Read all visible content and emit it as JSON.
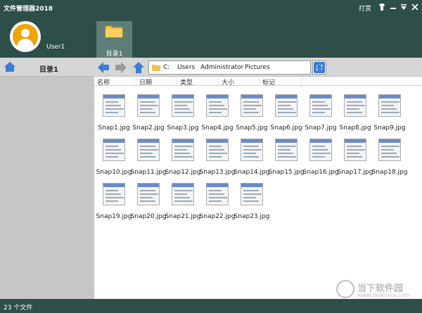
{
  "window": {
    "title": "文件管理器2018",
    "reward_label": "打赏",
    "controls": [
      "shirt-icon",
      "minimize-icon",
      "menu-icon",
      "close-icon"
    ]
  },
  "user": {
    "name": "User1"
  },
  "tabs": [
    {
      "label": "目录1"
    }
  ],
  "left_panel": {
    "title": "目录1"
  },
  "path": {
    "segments": [
      "C:",
      "Users",
      "Administrator",
      "Pictures"
    ]
  },
  "columns": [
    "名称",
    "日期",
    "类型",
    "大小",
    "标记"
  ],
  "files": [
    {
      "name": "Snap1.jpg"
    },
    {
      "name": "Snap2.jpg"
    },
    {
      "name": "Snap3.jpg"
    },
    {
      "name": "Snap4.jpg"
    },
    {
      "name": "Snap5.jpg"
    },
    {
      "name": "Snap6.jpg"
    },
    {
      "name": "Snap7.jpg"
    },
    {
      "name": "Snap8.jpg"
    },
    {
      "name": "Snap9.jpg"
    },
    {
      "name": "Snap10.jpg"
    },
    {
      "name": "Snap11.jpg"
    },
    {
      "name": "Snap12.jpg"
    },
    {
      "name": "Snap13.jpg"
    },
    {
      "name": "Snap14.jpg"
    },
    {
      "name": "Snap15.jpg"
    },
    {
      "name": "Snap16.jpg"
    },
    {
      "name": "Snap17.jpg"
    },
    {
      "name": "Snap18.jpg"
    },
    {
      "name": "Snap19.jpg"
    },
    {
      "name": "Snap20.jpg"
    },
    {
      "name": "Snap21.jpg"
    },
    {
      "name": "Snap22.jpg"
    },
    {
      "name": "Snap23.jpg"
    }
  ],
  "status": {
    "text": "23 个文件"
  },
  "watermark": {
    "text": "当下软件园",
    "url": "www.downxia.com"
  },
  "colors": {
    "header": "#2e4e48",
    "tab": "#5f7d78",
    "accent_blue": "#3a7bd5"
  }
}
